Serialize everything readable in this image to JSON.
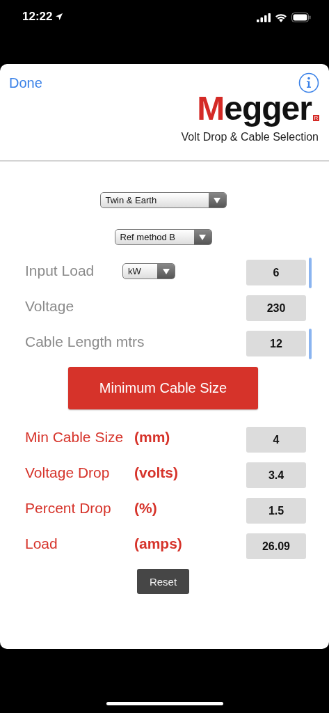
{
  "status_bar": {
    "time": "12:22"
  },
  "header": {
    "done": "Done",
    "logo": {
      "accent": "M",
      "rest": "egger",
      "mark": "R"
    },
    "subtitle": "Volt Drop & Cable Selection"
  },
  "selects": [
    {
      "value": "Twin & Earth"
    },
    {
      "value": "Ref method B"
    }
  ],
  "inputs": [
    {
      "label": "Input Load",
      "unit_select": "kW",
      "value": "6",
      "accent_bar": true
    },
    {
      "label": "Voltage",
      "value": "230",
      "accent_bar": false
    },
    {
      "label": "Cable Length mtrs",
      "value": "12",
      "accent_bar": true
    }
  ],
  "action_button": "Minimum Cable Size",
  "results": [
    {
      "label": "Min Cable Size",
      "unit": "(mm)",
      "value": "4"
    },
    {
      "label": "Voltage Drop",
      "unit": "(volts)",
      "value": "3.4"
    },
    {
      "label": "Percent Drop",
      "unit": "(%)",
      "value": "1.5"
    },
    {
      "label": "Load",
      "unit": "(amps)",
      "value": "26.09"
    }
  ],
  "reset_button": "Reset"
}
